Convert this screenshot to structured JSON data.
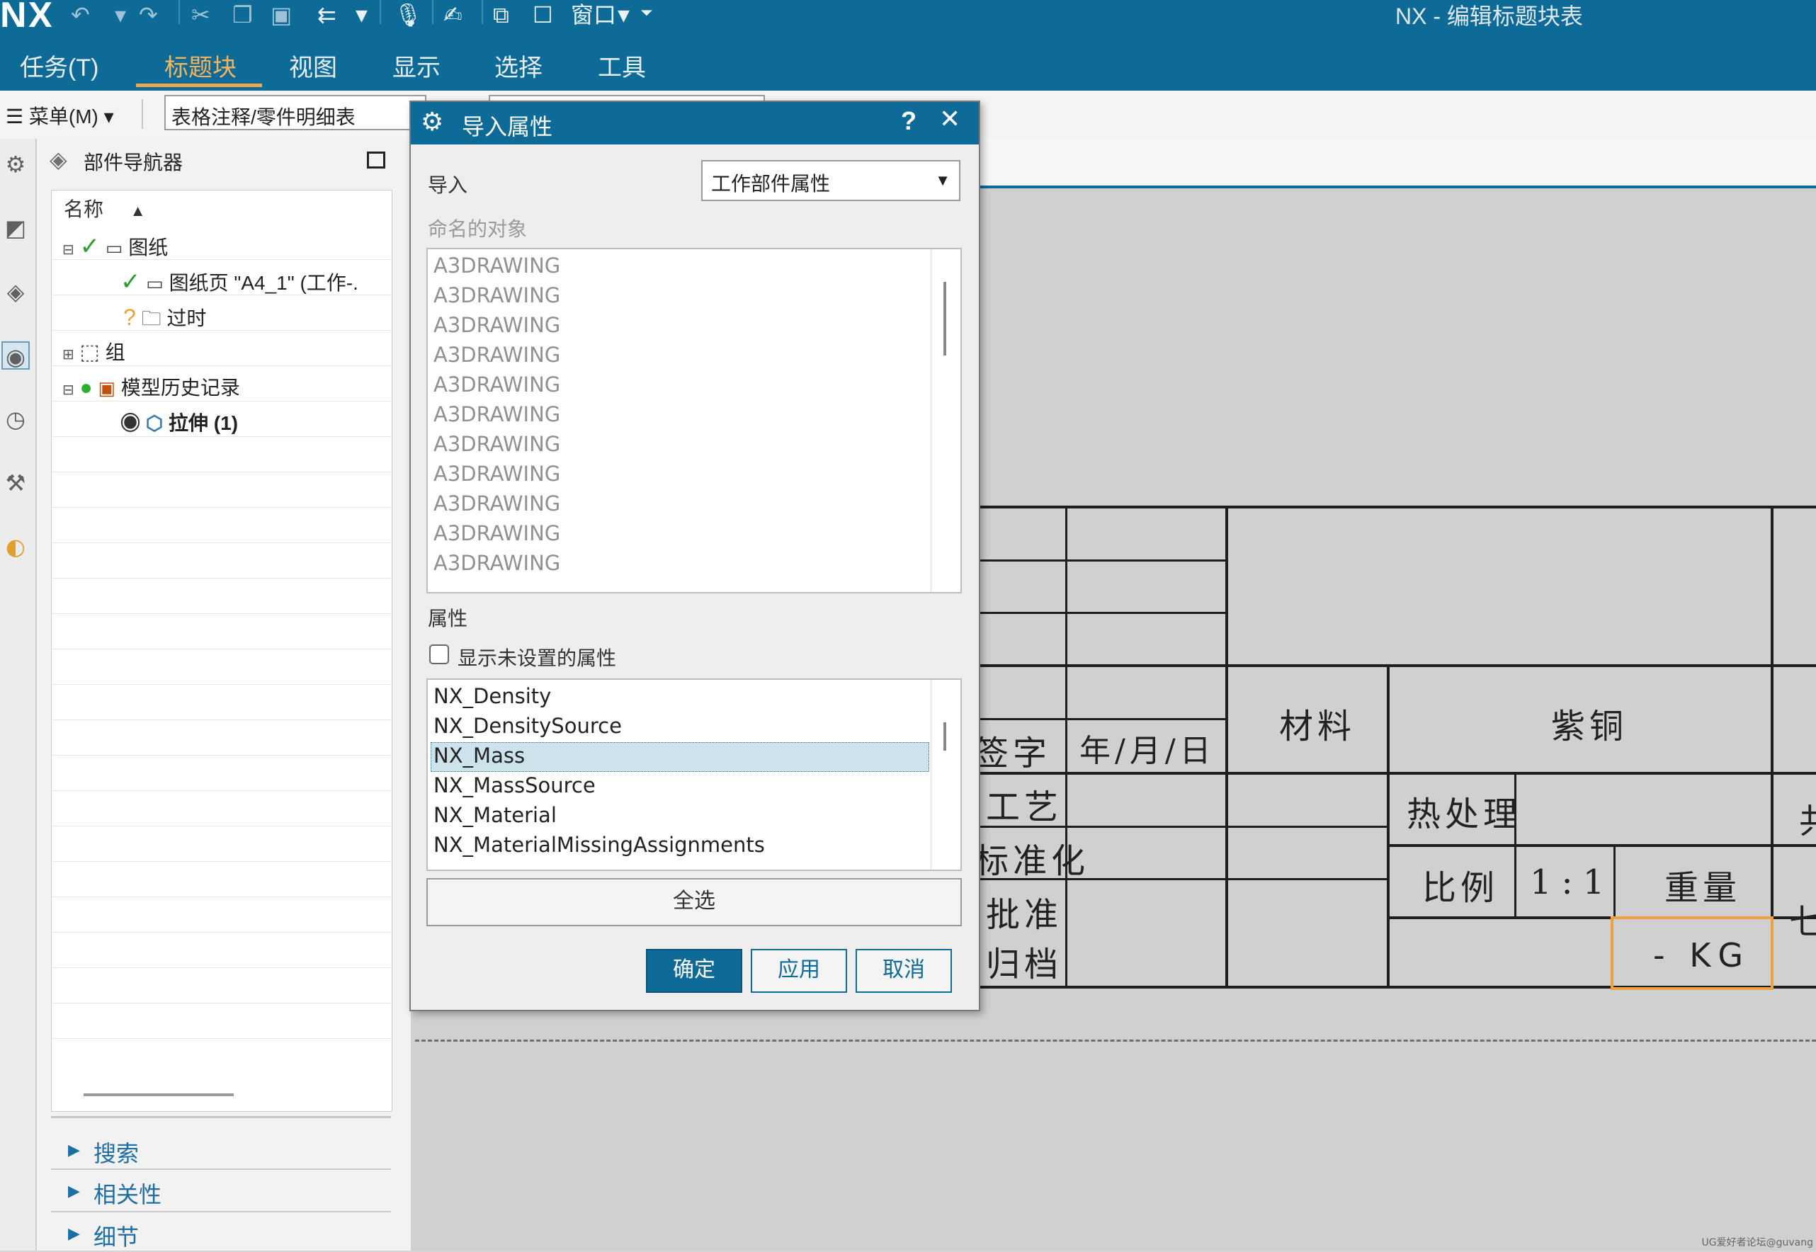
{
  "app": {
    "logo": "NX",
    "window_title": "NX - 编辑标题块表"
  },
  "ribbon": {
    "tabs": [
      {
        "label": "任务(T)"
      },
      {
        "label": "标题块"
      },
      {
        "label": "视图"
      },
      {
        "label": "显示"
      },
      {
        "label": "选择"
      },
      {
        "label": "工具"
      }
    ],
    "active_tab": "标题块",
    "window_menu": "窗口"
  },
  "toolbar": {
    "menu_label": "菜单(M)",
    "filter_value": "表格注释/零件明细表",
    "second_combo_value": ""
  },
  "navigator": {
    "title": "部件导航器",
    "column_header": "名称",
    "tree": [
      {
        "label": "图纸"
      },
      {
        "label": "图纸页 \"A4_1\" (工作-."
      },
      {
        "label": "过时"
      },
      {
        "label": "组"
      },
      {
        "label": "模型历史记录"
      },
      {
        "label": "拉伸 (1)"
      }
    ],
    "sections": [
      {
        "label": "搜索"
      },
      {
        "label": "相关性"
      },
      {
        "label": "细节"
      }
    ]
  },
  "dialog": {
    "title": "导入属性",
    "help": "?",
    "close": "✕",
    "import_label": "导入",
    "import_value": "工作部件属性",
    "named_objects_label": "命名的对象",
    "named_objects": [
      "A3DRAWING",
      "A3DRAWING",
      "A3DRAWING",
      "A3DRAWING",
      "A3DRAWING",
      "A3DRAWING",
      "A3DRAWING",
      "A3DRAWING",
      "A3DRAWING",
      "A3DRAWING",
      "A3DRAWING"
    ],
    "attributes_label": "属性",
    "show_unset_label": "显示未设置的属性",
    "show_unset_checked": false,
    "attributes": [
      "NX_Density",
      "NX_DensitySource",
      "NX_Mass",
      "NX_MassSource",
      "NX_Material",
      "NX_MaterialMissingAssignments"
    ],
    "selected_attribute": "NX_Mass",
    "select_all": "全选",
    "ok": "确定",
    "apply": "应用",
    "cancel": "取消"
  },
  "title_block": {
    "sign": "签字",
    "date": "年/月/日",
    "material_label": "材料",
    "material_value": "紫铜",
    "process": "工艺",
    "heat_treatment": "热处理",
    "standardization": "标准化",
    "scale_label": "比例",
    "scale_value": "1:1",
    "weight_label": "重量",
    "approve": "批准",
    "archive": "归档",
    "weight_value": "- KG",
    "edge_char_1": "共",
    "edge_char_2": "七"
  },
  "watermark": "UG爱好者论坛@guvang",
  "colors": {
    "brand": "#0e6a96",
    "accent": "#f0a64c",
    "selection": "#cde3ec"
  }
}
